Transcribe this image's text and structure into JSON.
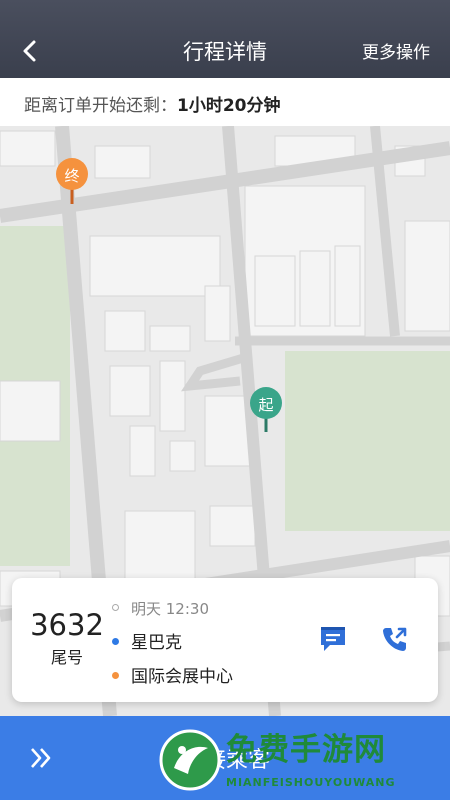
{
  "header": {
    "title": "行程详情",
    "more_label": "更多操作"
  },
  "countdown": {
    "label": "距离订单开始还剩：",
    "value": "1小时20分钟"
  },
  "map": {
    "end_marker": "终",
    "start_marker": "起"
  },
  "card": {
    "tail_number": "3632",
    "tail_label": "尾号",
    "time": "明天 12:30",
    "origin": "星巴克",
    "destination": "国际会展中心",
    "message_icon": "message-icon",
    "phone_icon": "phone-icon"
  },
  "bottom": {
    "slide_label": "滑动接乘客",
    "chevron_icon": "double-chevron-right-icon"
  },
  "watermark": {
    "text": "免费手游网",
    "sub": "MIANFEISHOUYOUWANG"
  },
  "colors": {
    "header_bg": "#3f4452",
    "accent_blue": "#3b7de6",
    "origin_dot": "#2f7ae5",
    "dest_dot": "#f5923e",
    "start_pin": "#3aa58a",
    "end_pin": "#f5923e",
    "map_green": "#d7e3cf"
  }
}
